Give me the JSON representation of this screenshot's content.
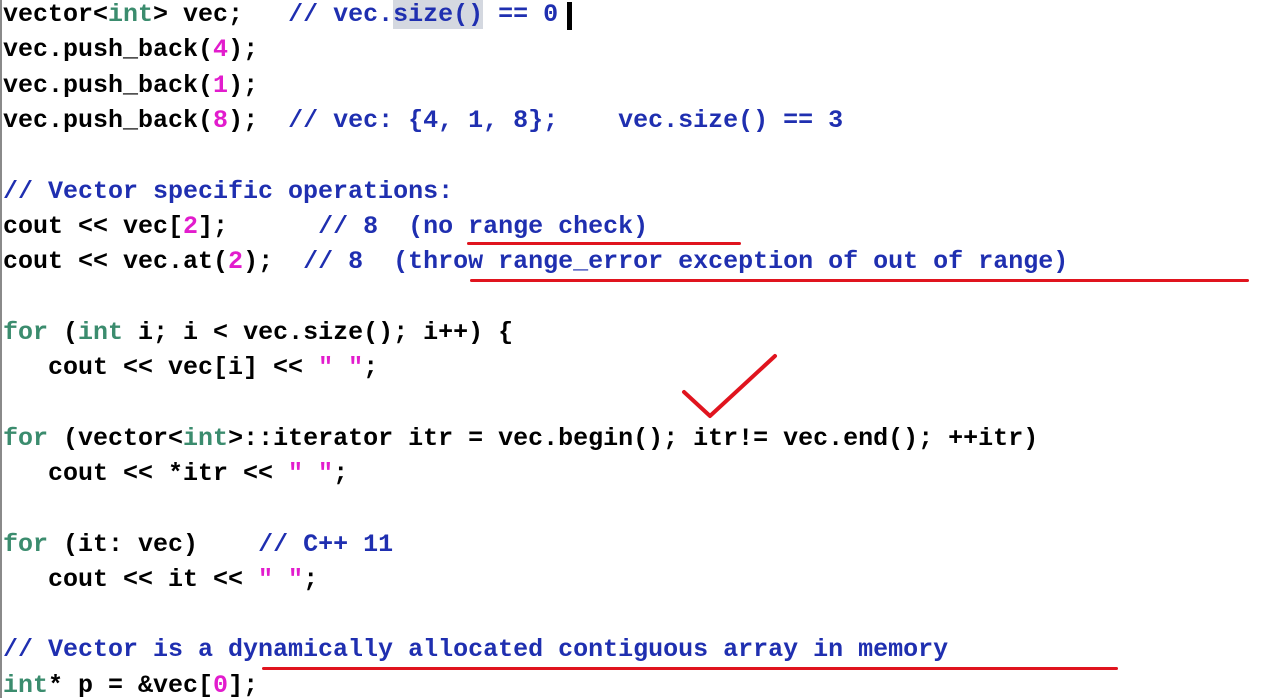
{
  "lines": [
    [
      {
        "t": "vector<",
        "c": ""
      },
      {
        "t": "int",
        "c": "kw"
      },
      {
        "t": "> vec;   ",
        "c": ""
      },
      {
        "t": "// vec.",
        "c": "cmt"
      },
      {
        "t": "size()",
        "c": "cmt sel"
      },
      {
        "t": " == 0",
        "c": "cmt"
      }
    ],
    [
      {
        "t": "vec.push_back(",
        "c": ""
      },
      {
        "t": "4",
        "c": "num"
      },
      {
        "t": ");",
        "c": ""
      }
    ],
    [
      {
        "t": "vec.push_back(",
        "c": ""
      },
      {
        "t": "1",
        "c": "num"
      },
      {
        "t": ");",
        "c": ""
      }
    ],
    [
      {
        "t": "vec.push_back(",
        "c": ""
      },
      {
        "t": "8",
        "c": "num"
      },
      {
        "t": ");  ",
        "c": ""
      },
      {
        "t": "// vec: {4, 1, 8};    vec.size() == 3",
        "c": "cmt"
      }
    ],
    [],
    [
      {
        "t": "// Vector specific operations:",
        "c": "cmt"
      }
    ],
    [
      {
        "t": "cout << vec[",
        "c": ""
      },
      {
        "t": "2",
        "c": "num"
      },
      {
        "t": "];      ",
        "c": ""
      },
      {
        "t": "// 8  (no range check)",
        "c": "cmt"
      }
    ],
    [
      {
        "t": "cout << vec.at(",
        "c": ""
      },
      {
        "t": "2",
        "c": "num"
      },
      {
        "t": ");  ",
        "c": ""
      },
      {
        "t": "// 8  (throw range_error exception of out of range)",
        "c": "cmt"
      }
    ],
    [],
    [
      {
        "t": "for",
        "c": "kw"
      },
      {
        "t": " (",
        "c": ""
      },
      {
        "t": "int",
        "c": "kw"
      },
      {
        "t": " i; i < vec.size(); i++) {",
        "c": ""
      }
    ],
    [
      {
        "t": "   cout << vec[i] << ",
        "c": ""
      },
      {
        "t": "\" \"",
        "c": "str"
      },
      {
        "t": ";",
        "c": ""
      }
    ],
    [],
    [
      {
        "t": "for",
        "c": "kw"
      },
      {
        "t": " (vector<",
        "c": ""
      },
      {
        "t": "int",
        "c": "kw"
      },
      {
        "t": ">::iterator itr = vec.begin(); itr!= vec.end(); ++itr)",
        "c": ""
      }
    ],
    [
      {
        "t": "   cout << *itr << ",
        "c": ""
      },
      {
        "t": "\" \"",
        "c": "str"
      },
      {
        "t": ";",
        "c": ""
      }
    ],
    [],
    [
      {
        "t": "for",
        "c": "kw"
      },
      {
        "t": " (it: vec)    ",
        "c": ""
      },
      {
        "t": "// C++ 11",
        "c": "cmt"
      }
    ],
    [
      {
        "t": "   cout << it << ",
        "c": ""
      },
      {
        "t": "\" \"",
        "c": "str"
      },
      {
        "t": ";",
        "c": ""
      }
    ],
    [],
    [
      {
        "t": "// Vector is a dynamically allocated contiguous array in memory",
        "c": "cmt"
      }
    ],
    [
      {
        "t": "int",
        "c": "kw"
      },
      {
        "t": "* p = &vec[",
        "c": ""
      },
      {
        "t": "0",
        "c": "num"
      },
      {
        "t": "];",
        "c": ""
      }
    ]
  ],
  "colors": {
    "keyword": "#3b8c6e",
    "number": "#e21ccd",
    "comment": "#1f2fb0",
    "default": "#000000",
    "annotation": "#e0141e",
    "selection": "#d4d8e0"
  },
  "annotations": [
    {
      "name": "underline-no-range-check",
      "kind": "underline"
    },
    {
      "name": "underline-throw-range-error",
      "kind": "underline"
    },
    {
      "name": "checkmark-icon",
      "kind": "checkmark"
    },
    {
      "name": "underline-dynamically-allocated",
      "kind": "underline"
    }
  ]
}
